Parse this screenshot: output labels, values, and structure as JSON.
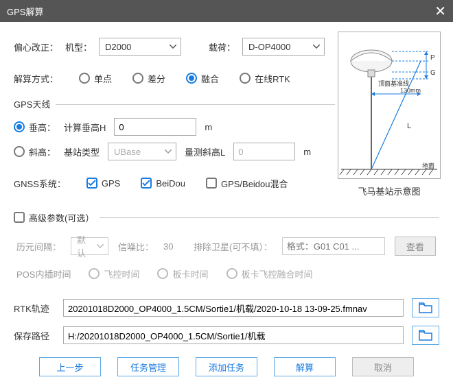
{
  "title": "GPS解算",
  "eccentricity": {
    "label": "偏心改正：",
    "model_lbl": "机型：",
    "model_val": "D2000",
    "payload_lbl": "载荷：",
    "payload_val": "D-OP4000"
  },
  "method": {
    "label": "解算方式：",
    "opts": [
      "单点",
      "差分",
      "融合",
      "在线RTK"
    ]
  },
  "antenna": {
    "group": "GPS天线",
    "vert_lbl": "垂高：",
    "calc_lbl": "计算垂高H",
    "calc_val": "0",
    "unit_m": "m",
    "slant_lbl": "斜高：",
    "station_type_lbl": "基站类型",
    "station_type_val": "UBase",
    "slant_meas_lbl": "量测斜高L",
    "slant_meas_val": "0"
  },
  "gnss": {
    "label": "GNSS系统：",
    "gps": "GPS",
    "beidou": "BeiDou",
    "mix": "GPS/Beidou混合"
  },
  "advanced": {
    "group": "高级参数(可选）",
    "epoch_lbl": "历元间隔：",
    "epoch_val": "默认",
    "snr_lbl": "信噪比：",
    "snr_val": "30",
    "exclude_lbl": "排除卫星(可不填）：",
    "exclude_ph": "格式：G01 C01 ...",
    "view_btn": "查看",
    "pos_lbl": "POS内插时间",
    "opts": [
      "飞控时间",
      "板卡时间",
      "板卡飞控融合时间"
    ]
  },
  "paths": {
    "rtk_lbl": "RTK轨迹",
    "rtk_val": "20201018D2000_OP4000_1.5CM/Sortie1/机载/2020-10-18 13-09-25.fmnav",
    "save_lbl": "保存路径",
    "save_val": "H:/20201018D2000_OP4000_1.5CM/Sortie1/机载"
  },
  "footer": {
    "prev": "上一步",
    "task_mgr": "任务管理",
    "add_task": "添加任务",
    "solve": "解算",
    "cancel": "取消"
  },
  "diagram": {
    "caption": "飞马基站示意图",
    "baseline": "顶面基准线",
    "dim": "130mm",
    "letters": {
      "p": "P",
      "g": "G",
      "l": "L"
    },
    "ground": "地面"
  }
}
